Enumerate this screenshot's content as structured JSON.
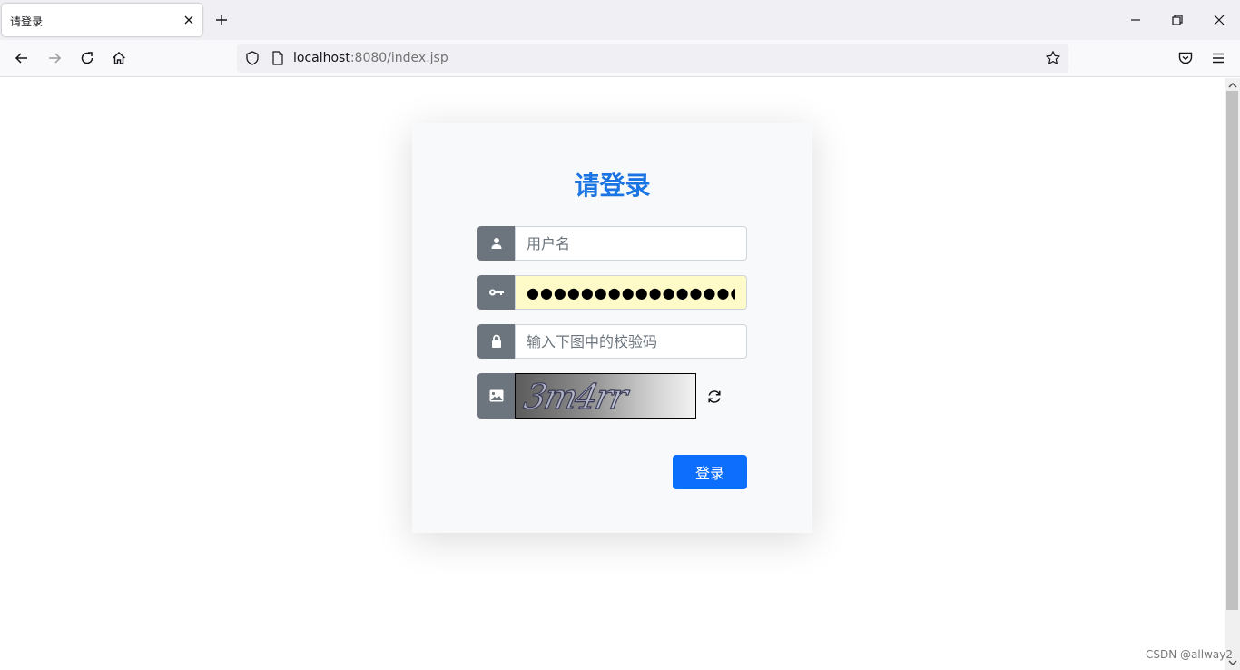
{
  "browser": {
    "tab_title": "请登录",
    "url_host": "localhost",
    "url_path": ":8080/index.jsp"
  },
  "login": {
    "title": "请登录",
    "username_placeholder": "用户名",
    "password_value": "●●●●●●●●●●●●●●●●",
    "captcha_placeholder": "输入下图中的校验码",
    "captcha_text": "3m4rr",
    "submit_label": "登录"
  },
  "watermark": "CSDN @allway2",
  "colors": {
    "title": "#1b74e4",
    "primary_button": "#0d6efd",
    "icon_addon": "#6c757d",
    "autofill": "#fffbc8"
  },
  "icons": {
    "username": "person-icon",
    "password": "key-icon",
    "captcha_input": "lock-icon",
    "captcha_image": "image-icon",
    "refresh": "refresh-icon"
  }
}
